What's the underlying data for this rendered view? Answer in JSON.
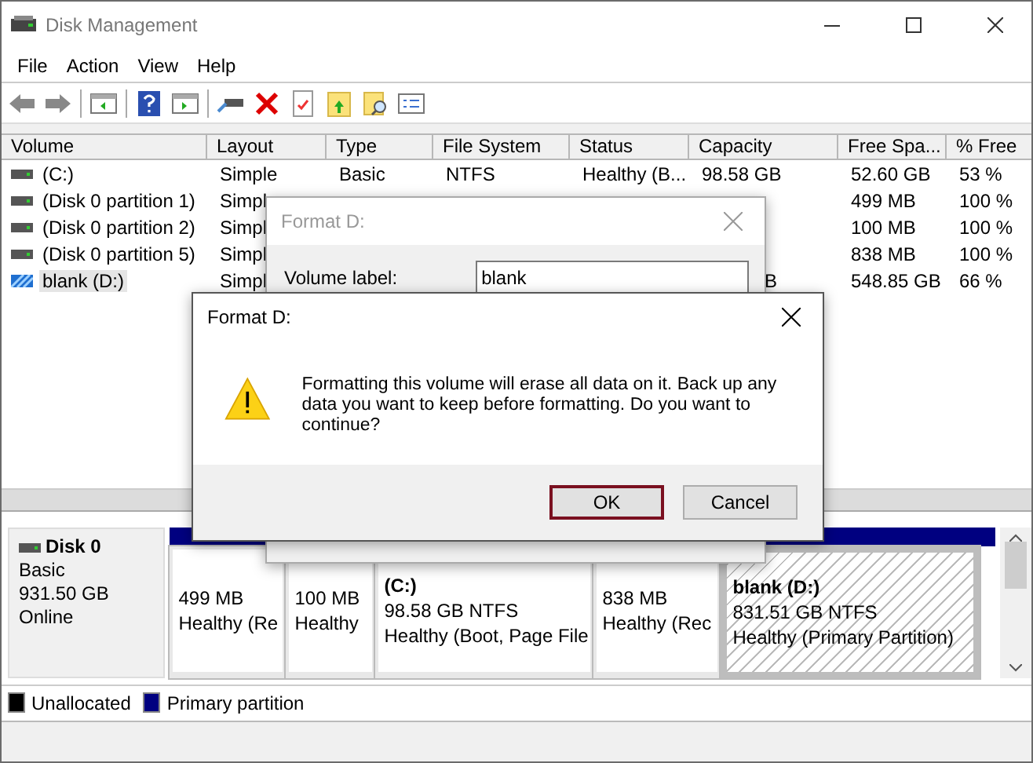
{
  "window": {
    "title": "Disk Management"
  },
  "menu": [
    "File",
    "Action",
    "View",
    "Help"
  ],
  "table": {
    "columns": [
      "Volume",
      "Layout",
      "Type",
      "File System",
      "Status",
      "Capacity",
      "Free Spa...",
      "% Free"
    ],
    "rows": [
      {
        "kind": "disk",
        "selected": false,
        "cells": [
          "(C:)",
          "Simple",
          "Basic",
          "NTFS",
          "Healthy (B...",
          "98.58 GB",
          "52.60 GB",
          "53 %"
        ]
      },
      {
        "kind": "disk",
        "selected": false,
        "cells": [
          "(Disk 0 partition 1)",
          "Simpl",
          "",
          "",
          "",
          "",
          "499 MB",
          "100 %"
        ]
      },
      {
        "kind": "disk",
        "selected": false,
        "cells": [
          "(Disk 0 partition 2)",
          "Simpl",
          "",
          "",
          "",
          "",
          "100 MB",
          "100 %"
        ]
      },
      {
        "kind": "disk",
        "selected": false,
        "cells": [
          "(Disk 0 partition 5)",
          "Simpl",
          "",
          "",
          "",
          "",
          "838 MB",
          "100 %"
        ]
      },
      {
        "kind": "striped",
        "selected": true,
        "cells": [
          "blank (D:)",
          "Simpl",
          "",
          "",
          "",
          "B",
          "548.85 GB",
          "66 %"
        ]
      }
    ]
  },
  "disk": {
    "name": "Disk 0",
    "type": "Basic",
    "size": "931.50 GB",
    "state": "Online",
    "partitions": [
      {
        "selected": false,
        "size": "499 MB",
        "status": "Healthy (Re"
      },
      {
        "selected": false,
        "size": "100 MB",
        "status": "Healthy"
      },
      {
        "selected": false,
        "label": "(C:)",
        "size": "98.58 GB NTFS",
        "status": "Healthy (Boot, Page File"
      },
      {
        "selected": false,
        "size": "838 MB",
        "status": "Healthy (Rec"
      },
      {
        "selected": true,
        "label": "blank  (D:)",
        "size": "831.51 GB NTFS",
        "status": "Healthy (Primary Partition)"
      }
    ]
  },
  "legend": [
    {
      "label": "Unallocated",
      "color": "#000000"
    },
    {
      "label": "Primary partition",
      "color": "#000080"
    }
  ],
  "format_dialog": {
    "title": "Format D:",
    "fields": [
      {
        "label": "Volume label:",
        "value": "blank"
      }
    ]
  },
  "confirm_dialog": {
    "title": "Format D:",
    "message": "Formatting this volume will erase all data on it. Back up any data you want to keep before formatting. Do you want to continue?",
    "buttons": [
      {
        "label": "OK",
        "default": true
      },
      {
        "label": "Cancel",
        "default": false
      }
    ]
  }
}
